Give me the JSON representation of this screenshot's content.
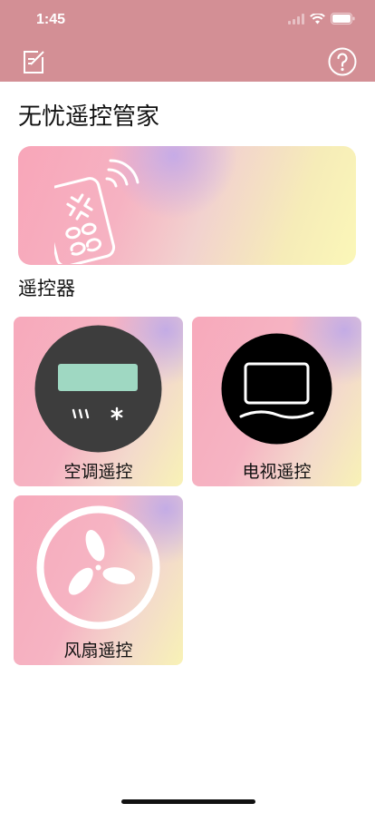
{
  "status_bar": {
    "time": "1:45"
  },
  "nav": {
    "left_icon": "edit-icon",
    "right_icon": "help-icon"
  },
  "app": {
    "title": "无忧遥控管家"
  },
  "banner": {
    "icon": "remote-control-icon"
  },
  "section": {
    "title": "遥控器"
  },
  "cards": [
    {
      "label": "空调遥控",
      "icon": "air-conditioner-icon"
    },
    {
      "label": "电视遥控",
      "icon": "tv-icon"
    },
    {
      "label": "风扇遥控",
      "icon": "fan-icon"
    }
  ],
  "colors": {
    "header": "#d38f95",
    "card_pink": "#f7a9bb",
    "card_yellow": "#f8f2b6",
    "card_purple": "#c4aae8"
  }
}
